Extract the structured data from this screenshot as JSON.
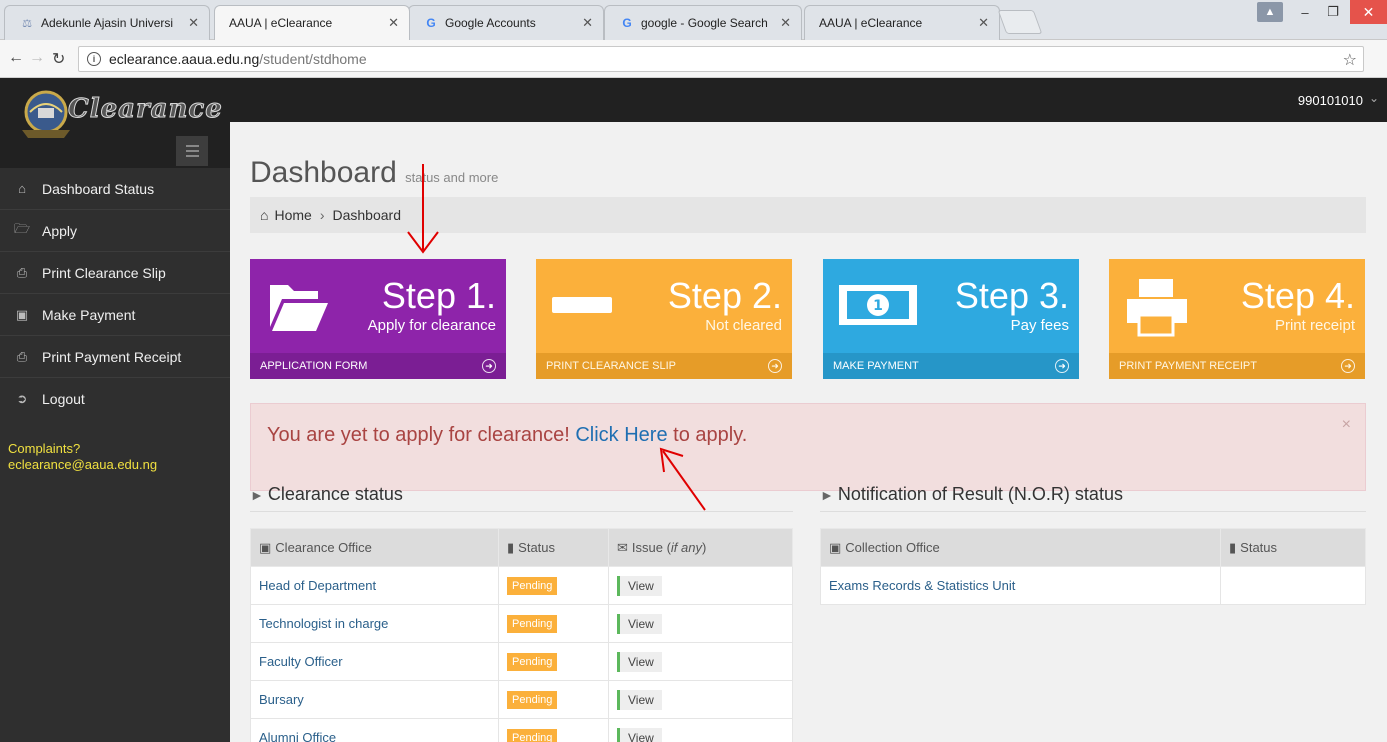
{
  "browser": {
    "tabs": [
      {
        "title": "Adekunle Ajasin Universi",
        "icon": "university-favicon",
        "active": false
      },
      {
        "title": "AAUA | eClearance",
        "icon": "blank-favicon",
        "active": true
      },
      {
        "title": "Google Accounts",
        "icon": "google-favicon",
        "active": false
      },
      {
        "title": "google - Google Search",
        "icon": "google-favicon",
        "active": false
      },
      {
        "title": "AAUA | eClearance",
        "icon": "blank-favicon",
        "active": false
      }
    ],
    "url_host": "eclearance.aaua.edu.ng",
    "url_path": "/student/stdhome"
  },
  "header": {
    "logo_text": "Clearance",
    "user_id": "990101010"
  },
  "sidebar": {
    "items": [
      {
        "label": "Dashboard Status",
        "icon": "home-icon"
      },
      {
        "label": "Apply",
        "icon": "folder-open-icon"
      },
      {
        "label": "Print Clearance Slip",
        "icon": "print-icon"
      },
      {
        "label": "Make Payment",
        "icon": "money-icon"
      },
      {
        "label": "Print Payment Receipt",
        "icon": "print-icon"
      },
      {
        "label": "Logout",
        "icon": "sign-out-icon"
      }
    ],
    "complaints_label": "Complaints?",
    "complaints_email": "eclearance@aaua.edu.ng"
  },
  "main": {
    "title": "Dashboard",
    "subtitle": "status and more",
    "breadcrumb": [
      "Home",
      "Dashboard"
    ],
    "steps": [
      {
        "title": "Step 1.",
        "desc": "Apply for clearance",
        "footer": "APPLICATION FORM",
        "color": "#8e24aa"
      },
      {
        "title": "Step 2.",
        "desc": "Not cleared",
        "footer": "PRINT CLEARANCE SLIP",
        "color": "#fbb03b"
      },
      {
        "title": "Step 3.",
        "desc": "Pay fees",
        "footer": "MAKE PAYMENT",
        "color": "#2ea9e0"
      },
      {
        "title": "Step 4.",
        "desc": "Print receipt",
        "footer": "PRINT PAYMENT RECEIPT",
        "color": "#fbb03b"
      }
    ],
    "alert": {
      "before": "You are yet to apply for clearance! ",
      "link": "Click Here",
      "after": " to apply."
    },
    "clearance": {
      "title": "Clearance status",
      "headers": {
        "office": "Clearance Office",
        "status": "Status",
        "issue": "Issue (",
        "issue_italic": "if any",
        "issue_close": ")"
      },
      "rows": [
        {
          "office": "Head of Department",
          "status": "Pending",
          "issue": "View"
        },
        {
          "office": "Technologist in charge",
          "status": "Pending",
          "issue": "View"
        },
        {
          "office": "Faculty Officer",
          "status": "Pending",
          "issue": "View"
        },
        {
          "office": "Bursary",
          "status": "Pending",
          "issue": "View"
        },
        {
          "office": "Alumni Office",
          "status": "Pending",
          "issue": "View"
        }
      ]
    },
    "nor": {
      "title": "Notification of Result (N.O.R) status",
      "headers": {
        "office": "Collection Office",
        "status": "Status"
      },
      "rows": [
        {
          "office": "Exams Records & Statistics Unit",
          "status": ""
        }
      ]
    }
  }
}
